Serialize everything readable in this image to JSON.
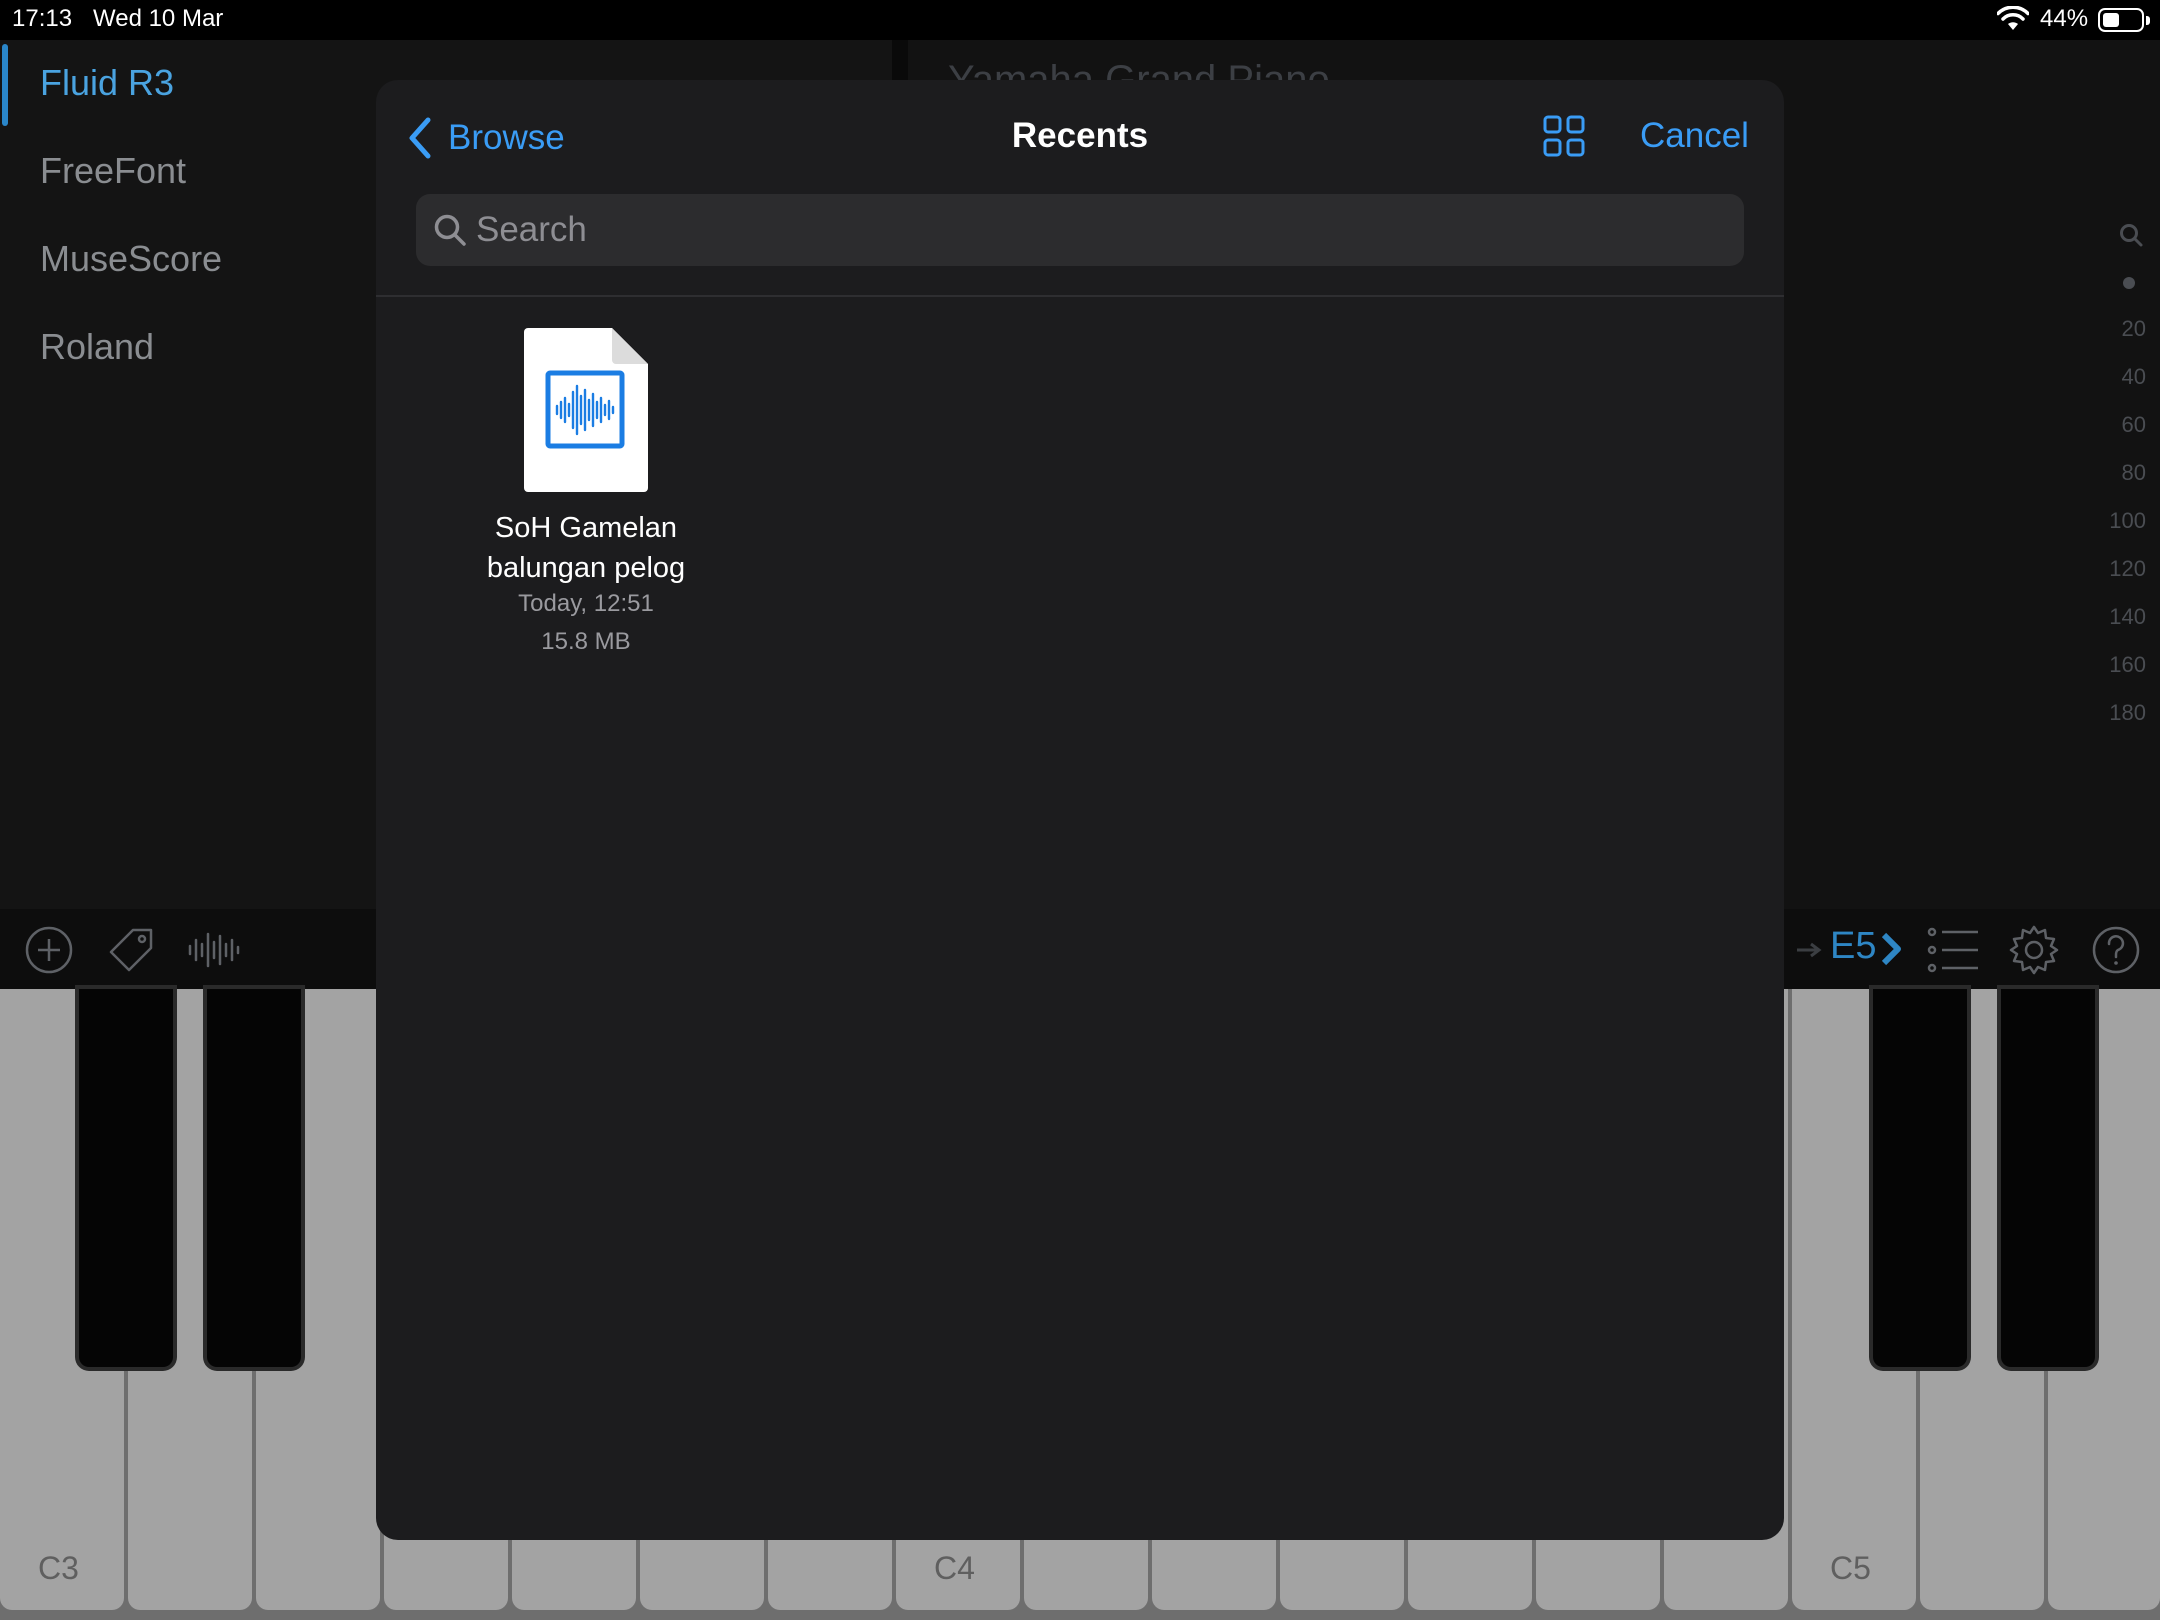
{
  "status_bar": {
    "time": "17:13",
    "date": "Wed 10 Mar",
    "battery": "44%"
  },
  "sidebar": {
    "items": [
      {
        "label": "Fluid R3",
        "selected": true
      },
      {
        "label": "FreeFont"
      },
      {
        "label": "MuseScore"
      },
      {
        "label": "Roland"
      }
    ]
  },
  "preset": {
    "title": "Yamaha Grand Piano"
  },
  "scale": {
    "values": [
      "20",
      "40",
      "60",
      "80",
      "100",
      "120",
      "140",
      "160",
      "180"
    ]
  },
  "toolbar": {
    "note": "E5"
  },
  "keyboard": {
    "labels": [
      "C3",
      "C4",
      "C5"
    ]
  },
  "picker": {
    "back_label": "Browse",
    "title": "Recents",
    "cancel_label": "Cancel",
    "search_placeholder": "Search",
    "files": [
      {
        "name": "SoH Gamelan balungan pelog",
        "date": "Today, 12:51",
        "size": "15.8 MB",
        "icon": "audio-waveform-icon"
      }
    ]
  },
  "colors": {
    "accent": "#3a9cf5",
    "app_accent": "#2a86c9",
    "modal_bg": "#1c1c1e"
  }
}
